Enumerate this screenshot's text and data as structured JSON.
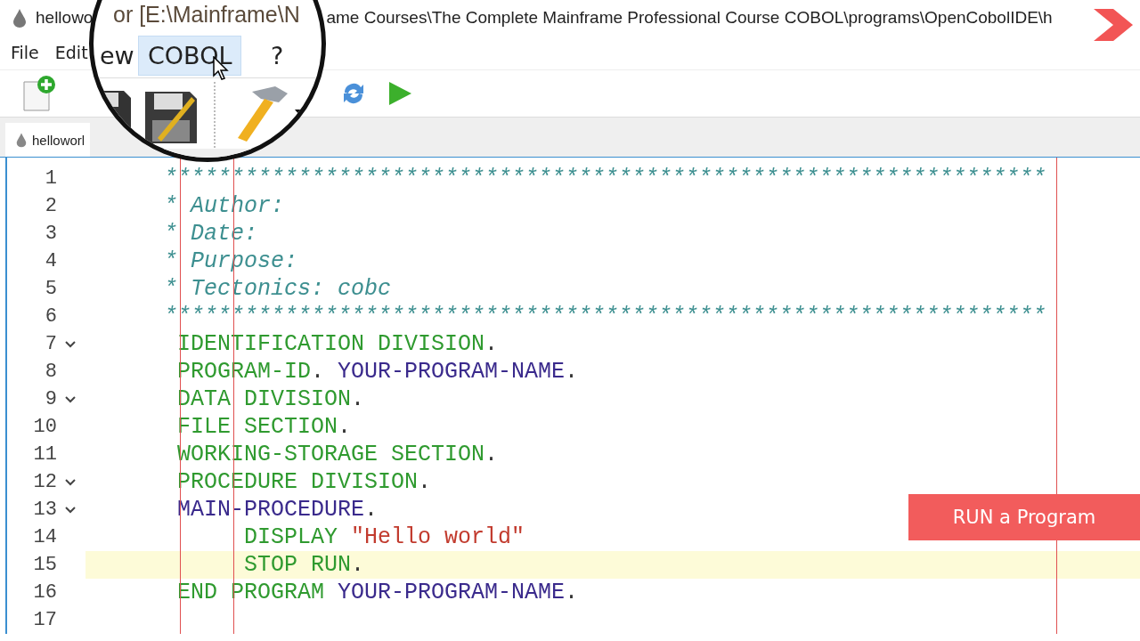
{
  "window": {
    "title_left": "hellowo",
    "title_right": "ame Courses\\The Complete Mainframe Professional Course COBOL\\programs\\OpenCobolIDE\\h"
  },
  "menu": [
    {
      "label": "File"
    },
    {
      "label": "Edit"
    }
  ],
  "tab": {
    "label": "helloworl"
  },
  "magnifier": {
    "title_fragment": "or [E:\\Mainframe\\N",
    "menu": [
      {
        "label": "ew",
        "selected": false
      },
      {
        "label": "COBOL",
        "selected": true
      },
      {
        "label": "?",
        "selected": false
      }
    ]
  },
  "editor": {
    "lines": [
      {
        "number": "1",
        "fold": false,
        "current": false,
        "tokens": [
          {
            "text": "      ******************************************************************",
            "kind": "comment"
          }
        ]
      },
      {
        "number": "2",
        "fold": false,
        "current": false,
        "tokens": [
          {
            "text": "      * Author:",
            "kind": "comment"
          }
        ]
      },
      {
        "number": "3",
        "fold": false,
        "current": false,
        "tokens": [
          {
            "text": "      * Date:",
            "kind": "comment"
          }
        ]
      },
      {
        "number": "4",
        "fold": false,
        "current": false,
        "tokens": [
          {
            "text": "      * Purpose:",
            "kind": "comment"
          }
        ]
      },
      {
        "number": "5",
        "fold": false,
        "current": false,
        "tokens": [
          {
            "text": "      * Tectonics: cobc",
            "kind": "comment"
          }
        ]
      },
      {
        "number": "6",
        "fold": false,
        "current": false,
        "tokens": [
          {
            "text": "      ******************************************************************",
            "kind": "comment"
          }
        ]
      },
      {
        "number": "7",
        "fold": true,
        "current": false,
        "tokens": [
          {
            "text": "       IDENTIFICATION DIVISION",
            "kind": "keyword"
          },
          {
            "text": ".",
            "kind": "punct"
          }
        ]
      },
      {
        "number": "8",
        "fold": false,
        "current": false,
        "tokens": [
          {
            "text": "       PROGRAM-ID",
            "kind": "keyword"
          },
          {
            "text": ". ",
            "kind": "punct"
          },
          {
            "text": "YOUR-PROGRAM-NAME",
            "kind": "ident"
          },
          {
            "text": ".",
            "kind": "punct"
          }
        ]
      },
      {
        "number": "9",
        "fold": true,
        "current": false,
        "tokens": [
          {
            "text": "       DATA DIVISION",
            "kind": "keyword"
          },
          {
            "text": ".",
            "kind": "punct"
          }
        ]
      },
      {
        "number": "10",
        "fold": false,
        "current": false,
        "tokens": [
          {
            "text": "       FILE SECTION",
            "kind": "keyword"
          },
          {
            "text": ".",
            "kind": "punct"
          }
        ]
      },
      {
        "number": "11",
        "fold": false,
        "current": false,
        "tokens": [
          {
            "text": "       WORKING-STORAGE SECTION",
            "kind": "keyword"
          },
          {
            "text": ".",
            "kind": "punct"
          }
        ]
      },
      {
        "number": "12",
        "fold": true,
        "current": false,
        "tokens": [
          {
            "text": "       PROCEDURE DIVISION",
            "kind": "keyword"
          },
          {
            "text": ".",
            "kind": "punct"
          }
        ]
      },
      {
        "number": "13",
        "fold": true,
        "current": false,
        "tokens": [
          {
            "text": "       MAIN-PROCEDURE",
            "kind": "ident"
          },
          {
            "text": ".",
            "kind": "punct"
          }
        ]
      },
      {
        "number": "14",
        "fold": false,
        "current": false,
        "tokens": [
          {
            "text": "            DISPLAY ",
            "kind": "keyword"
          },
          {
            "text": "\"Hello world\"",
            "kind": "string"
          }
        ]
      },
      {
        "number": "15",
        "fold": false,
        "current": true,
        "tokens": [
          {
            "text": "            STOP RUN",
            "kind": "keyword"
          },
          {
            "text": ".",
            "kind": "punct"
          }
        ]
      },
      {
        "number": "16",
        "fold": false,
        "current": false,
        "tokens": [
          {
            "text": "       END PROGRAM ",
            "kind": "keyword"
          },
          {
            "text": "YOUR-PROGRAM-NAME",
            "kind": "ident"
          },
          {
            "text": ".",
            "kind": "punct"
          }
        ]
      },
      {
        "number": "17",
        "fold": false,
        "current": false
      }
    ]
  },
  "banner": {
    "label": "RUN a Program"
  }
}
